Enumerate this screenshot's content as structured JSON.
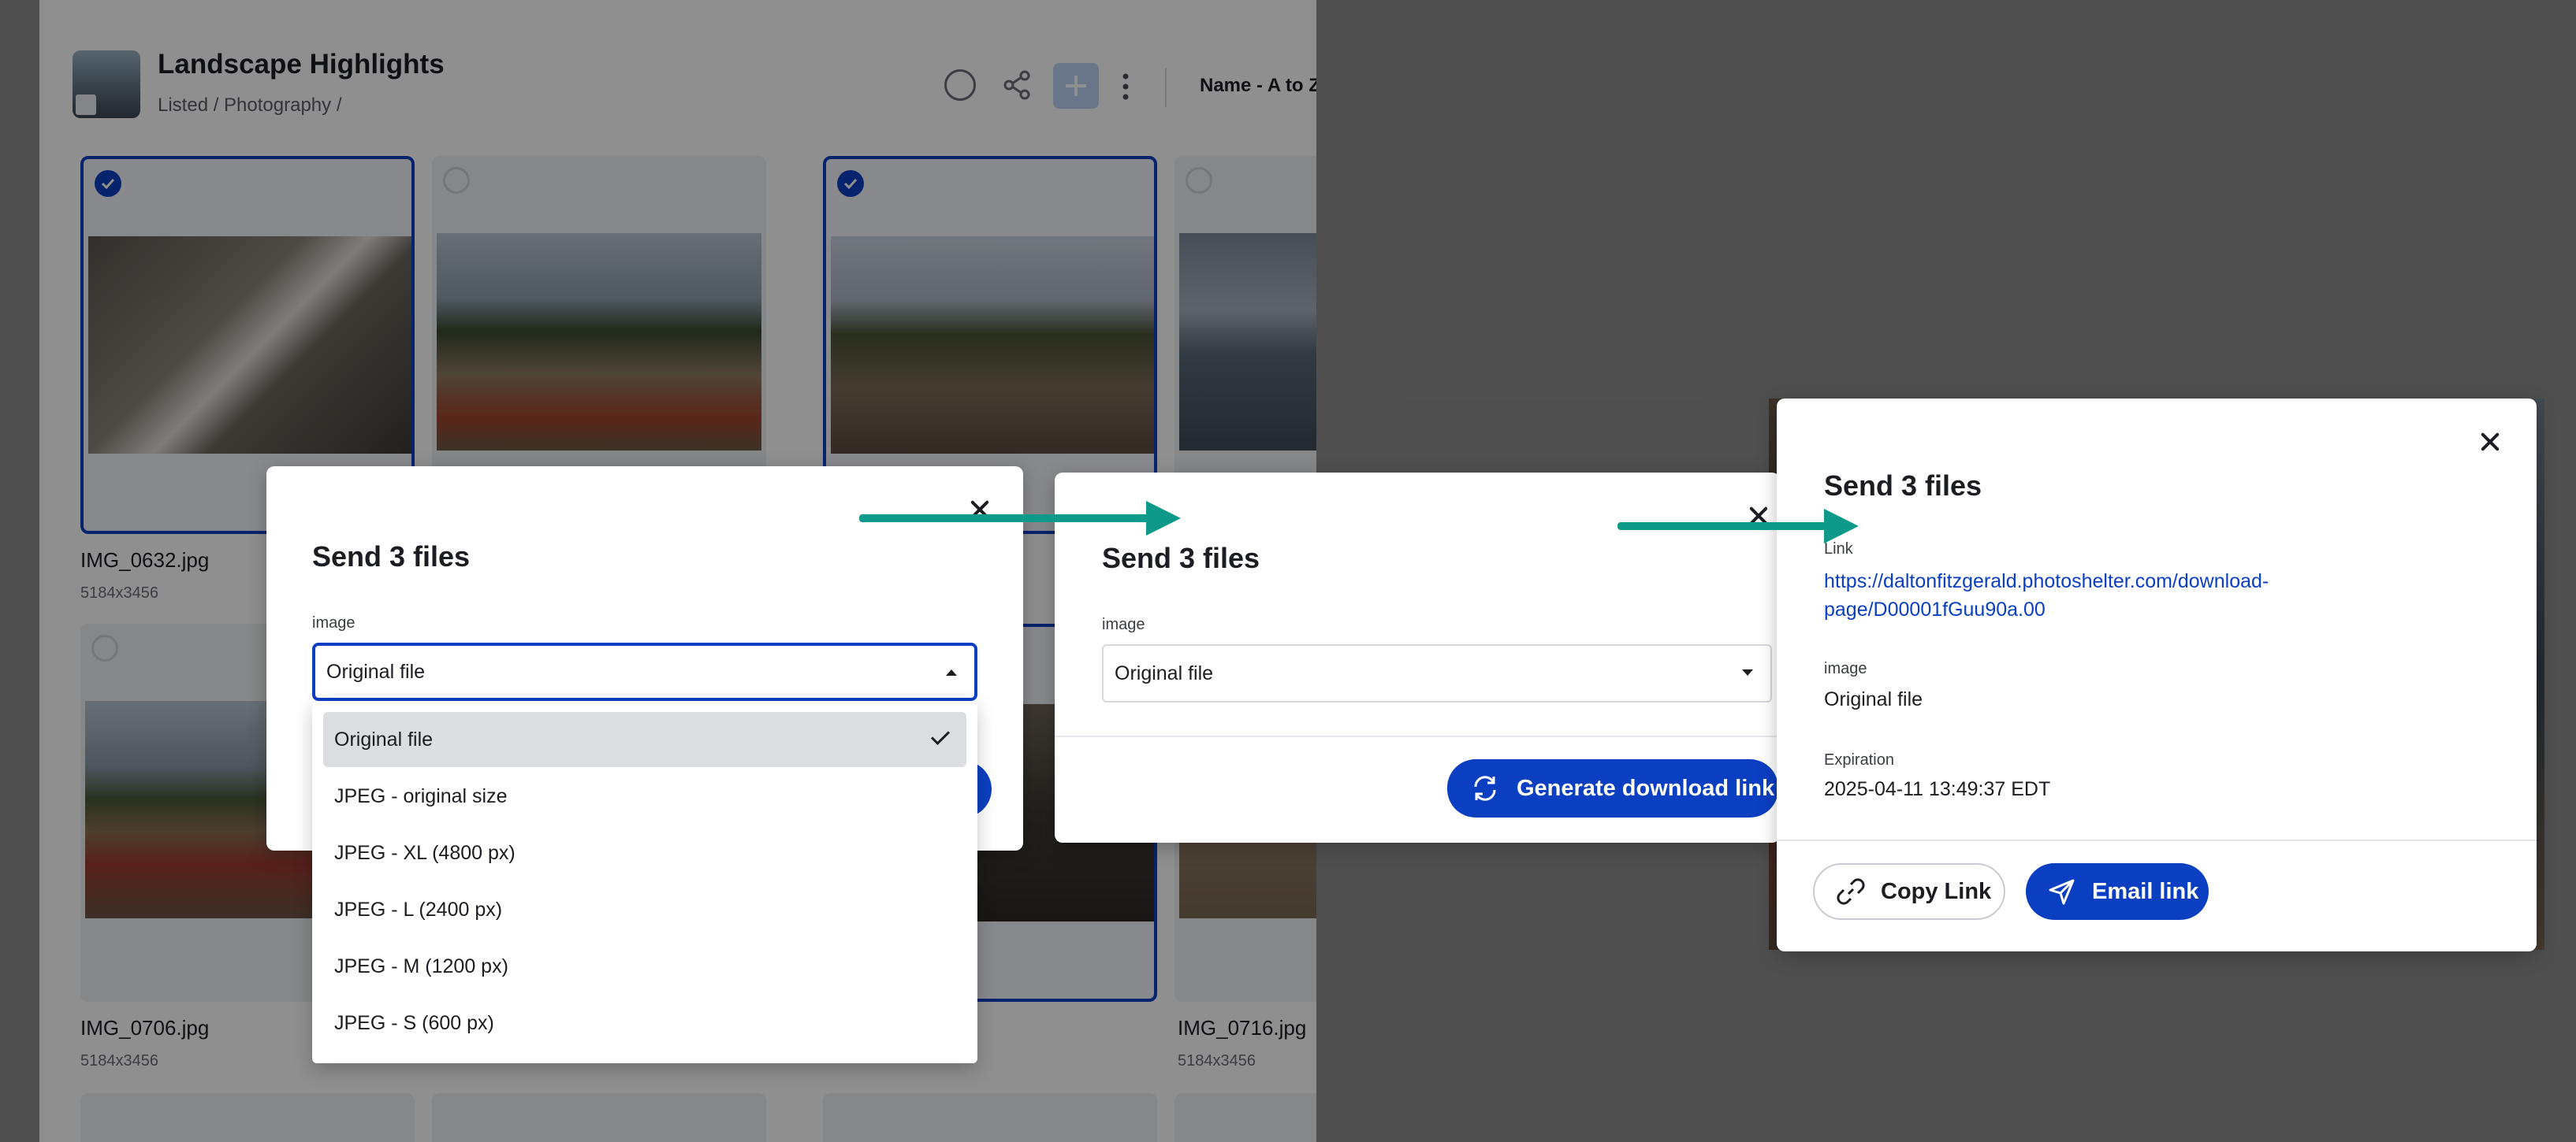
{
  "app": {
    "title": "Landscape Highlights",
    "breadcrumb": "Listed / Photography /",
    "sort_label": "Name - A to Z"
  },
  "tiles": [
    {
      "name": "IMG_0632.jpg",
      "dims": "5184x3456",
      "selected": true
    },
    {
      "name": "",
      "dims": "",
      "selected": false
    },
    {
      "name": "",
      "dims": "",
      "selected": true
    },
    {
      "name": "",
      "dims": "",
      "selected": false
    },
    {
      "name": "IMG_0706.jpg",
      "dims": "5184x3456",
      "selected": false
    },
    {
      "name": "IMG_0716.jpg",
      "dims": "5184x3456",
      "selected": false
    }
  ],
  "step1": {
    "title": "Send 3 files",
    "image_label": "image",
    "select_value": "Original file",
    "options": [
      "Original file",
      "JPEG - original size",
      "JPEG - XL (4800 px)",
      "JPEG - L (2400 px)",
      "JPEG - M (1200 px)",
      "JPEG - S (600 px)"
    ],
    "selected_index": 0
  },
  "step2": {
    "title": "Send 3 files",
    "image_label": "image",
    "select_value": "Original file",
    "generate_button": "Generate download link"
  },
  "step3": {
    "title": "Send 3 files",
    "link_label": "Link",
    "link_line1": "https://daltonfitzgerald.photoshelter.com/download-",
    "link_line2": "page/D00001fGuu90a.00",
    "image_label": "image",
    "image_value": "Original file",
    "expiration_label": "Expiration",
    "expiration_value": "2025-04-11 13:49:37 EDT",
    "copy_button": "Copy Link",
    "email_button": "Email link"
  },
  "colors": {
    "accent": "#0b3fc2",
    "arrow": "#0d9a8a",
    "overlay": "#8e8e8e"
  },
  "icons": [
    "info-icon",
    "share-icon",
    "plus-icon",
    "more-vertical-icon",
    "checkmark-icon",
    "close-icon",
    "chevron-up-icon",
    "chevron-down-icon",
    "refresh-icon",
    "link-icon",
    "send-icon"
  ]
}
